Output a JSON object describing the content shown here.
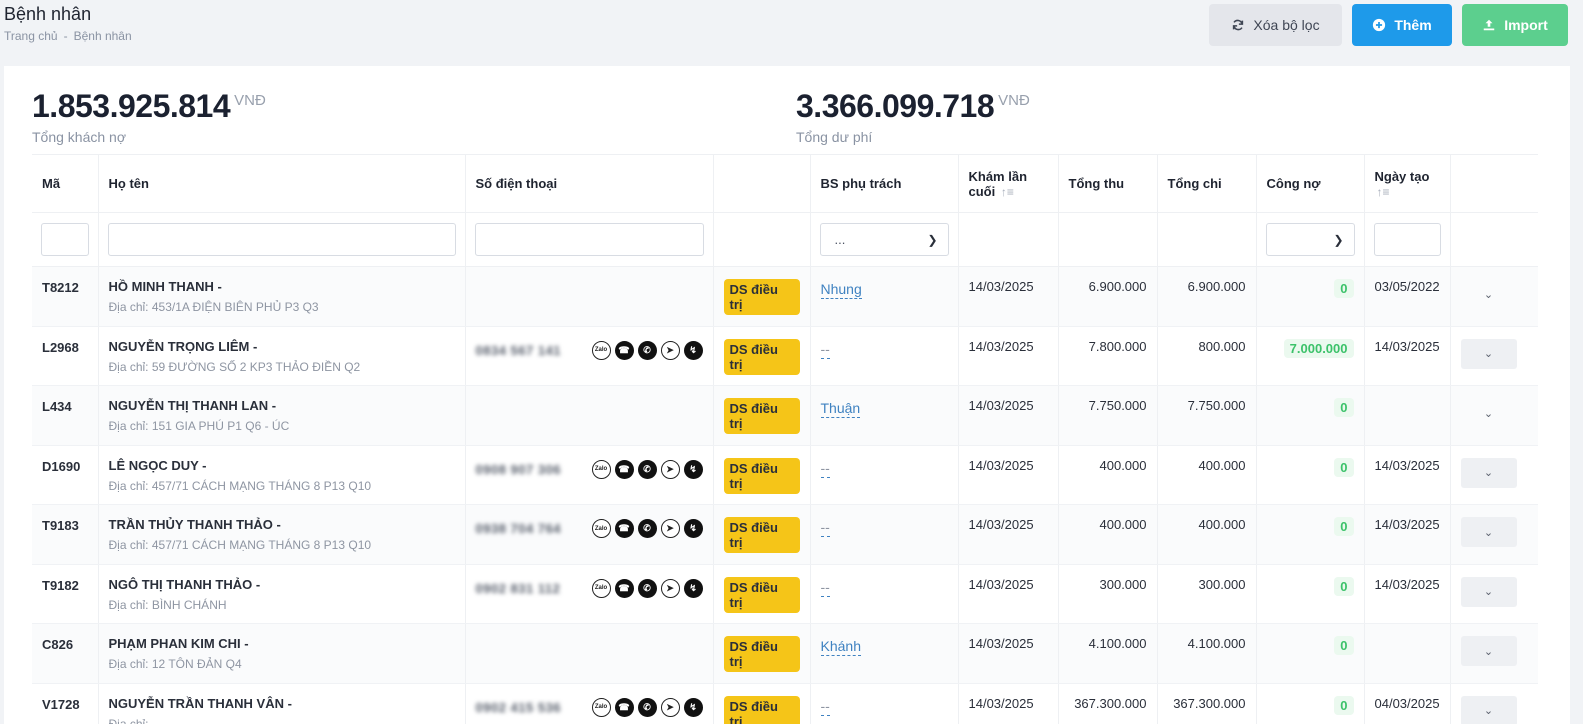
{
  "header": {
    "title": "Bệnh nhân",
    "breadcrumb": [
      "Trang chủ",
      "-",
      "Bệnh nhân"
    ],
    "buttons": {
      "clear": "Xóa bộ lọc",
      "add": "Thêm",
      "import": "Import"
    }
  },
  "stats": [
    {
      "value": "1.853.925.814",
      "unit": "VNĐ",
      "label": "Tổng khách nợ"
    },
    {
      "value": "3.366.099.718",
      "unit": "VNĐ",
      "label": "Tổng dư phí"
    }
  ],
  "table": {
    "columns": {
      "code": "Mã",
      "name": "Họ tên",
      "phone": "Số điện thoại",
      "doctor": "BS phụ trách",
      "last_visit_1": "Khám lần",
      "last_visit_2": "cuối",
      "income": "Tổng thu",
      "expense": "Tổng chi",
      "debt": "Công nợ",
      "created": "Ngày tạo"
    },
    "filter_doctor_placeholder": "...",
    "address_prefix": "Địa chỉ:",
    "rows": [
      {
        "code": "T8212",
        "name": "HỒ MINH THANH -",
        "address": "Địa chỉ: 453/1A ĐIỆN BIÊN PHỦ P3 Q3",
        "phone": "",
        "status": "DS điều trị",
        "doctor": "Nhung",
        "last_visit": "14/03/2025",
        "income": "6.900.000",
        "expense": "6.900.000",
        "debt": "0",
        "created": "03/05/2022"
      },
      {
        "code": "L2968",
        "name": "NGUYỄN TRỌNG LIÊM -",
        "address": "Địa chỉ: 59 ĐƯỜNG SỐ 2 KP3 THẢO ĐIỀN Q2",
        "phone": "0834 567 141",
        "status": "DS điều trị",
        "doctor": "--",
        "last_visit": "14/03/2025",
        "income": "7.800.000",
        "expense": "800.000",
        "debt": "7.000.000",
        "created": "14/03/2025"
      },
      {
        "code": "L434",
        "name": "NGUYỄN THỊ THANH LAN -",
        "address": "Địa chỉ: 151 GIA PHÚ P1 Q6 - ÚC",
        "phone": "",
        "status": "DS điều trị",
        "doctor": "Thuận",
        "last_visit": "14/03/2025",
        "income": "7.750.000",
        "expense": "7.750.000",
        "debt": "0",
        "created": ""
      },
      {
        "code": "D1690",
        "name": "LÊ NGỌC DUY -",
        "address": "Địa chỉ: 457/71 CÁCH MẠNG THÁNG 8 P13 Q10",
        "phone": "0908 907 306",
        "status": "DS điều trị",
        "doctor": "--",
        "last_visit": "14/03/2025",
        "income": "400.000",
        "expense": "400.000",
        "debt": "0",
        "created": "14/03/2025"
      },
      {
        "code": "T9183",
        "name": "TRẦN THỦY THANH THẢO -",
        "address": "Địa chỉ: 457/71 CÁCH MẠNG THÁNG 8 P13 Q10",
        "phone": "0938 704 764",
        "status": "DS điều trị",
        "doctor": "--",
        "last_visit": "14/03/2025",
        "income": "400.000",
        "expense": "400.000",
        "debt": "0",
        "created": "14/03/2025"
      },
      {
        "code": "T9182",
        "name": "NGÔ THỊ THANH THẢO -",
        "address": "Địa chỉ: BÌNH CHÁNH",
        "phone": "0902 831 112",
        "status": "DS điều trị",
        "doctor": "--",
        "last_visit": "14/03/2025",
        "income": "300.000",
        "expense": "300.000",
        "debt": "0",
        "created": "14/03/2025"
      },
      {
        "code": "C826",
        "name": "PHẠM PHAN KIM CHI -",
        "address": "Địa chỉ: 12 TÔN ĐẢN Q4",
        "phone": "",
        "status": "DS điều trị",
        "doctor": "Khánh",
        "last_visit": "14/03/2025",
        "income": "4.100.000",
        "expense": "4.100.000",
        "debt": "0",
        "created": ""
      },
      {
        "code": "V1728",
        "name": "NGUYỄN TRẦN THANH VÂN -",
        "address": "Địa chỉ: ...",
        "phone": "0902 415 536",
        "status": "DS điều trị",
        "doctor": "--",
        "last_visit": "14/03/2025",
        "income": "367.300.000",
        "expense": "367.300.000",
        "debt": "0",
        "created": "04/03/2025"
      }
    ]
  },
  "colors": {
    "primary": "#1e9aea",
    "success": "#5ccf8e",
    "badge": "#f5c518",
    "link": "#3f82c1",
    "debt_text": "#3cc26a"
  },
  "icons": [
    "refresh-icon",
    "plus-circle-icon",
    "upload-icon",
    "chevron-down-icon",
    "sort-icon",
    "zalo-icon",
    "viber-icon",
    "whatsapp-icon",
    "telegram-icon",
    "messenger-icon"
  ]
}
